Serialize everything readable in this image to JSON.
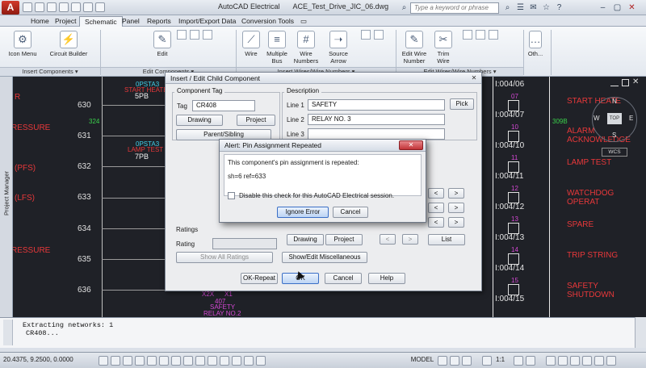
{
  "app": {
    "title_app": "AutoCAD Electrical",
    "title_file": "ACE_Test_Drive_JIC_06.dwg",
    "logo_letter": "A",
    "search_placeholder": "Type a keyword or phrase"
  },
  "tabs": [
    "Home",
    "Project",
    "Schematic",
    "Panel",
    "Reports",
    "Import/Export Data",
    "Conversion Tools"
  ],
  "ribbon": {
    "buttons": {
      "icon_menu": "Icon Menu",
      "circuit_builder": "Circuit Builder",
      "edit": "Edit",
      "wire": "Wire",
      "multiple_bus": "Multiple Bus",
      "wire_numbers": "Wire Numbers",
      "source_arrow": "Source Arrow",
      "edit_wire_number": "Edit Wire Number",
      "trim_wire": "Trim Wire",
      "other": "Oth..."
    },
    "panels": {
      "insert_components": "Insert Components ▾",
      "edit_components": "Edit Components ▾",
      "insert_wires": "Insert Wires/Wire Numbers ▾",
      "edit_wires": "Edit Wires/Wire Numbers ▾"
    }
  },
  "drawing": {
    "left_labels": [
      "R",
      "RESSURE",
      "(PFS)",
      "(LFS)",
      "RESSURE"
    ],
    "rungs": [
      "630",
      "631",
      "632",
      "633",
      "634",
      "635",
      "636"
    ],
    "green_label": "324",
    "green_label_right": "309B",
    "components": [
      {
        "tag": "0PSTA3",
        "desc": "START HEATER",
        "pb": "5PB"
      },
      {
        "tag": "0PSTA3",
        "desc": "LAMP TEST",
        "pb": "7PB"
      }
    ],
    "bottom_labels": [
      "X2X",
      "X1",
      "407",
      "SAFETY",
      "RELAY NO.2"
    ],
    "addresses": [
      "I:004/06",
      "I:004/07",
      "I:004/10",
      "I:004/11",
      "I:004/12",
      "I:004/13",
      "I:004/14",
      "I:004/15"
    ],
    "mag_numbers": [
      "07",
      "10",
      "11",
      "12",
      "13",
      "14",
      "15"
    ],
    "right_labels": [
      "START HEATE",
      "ALARM ACKNOWLEDGE",
      "LAMP TEST",
      "WATCHDOG OPERAT",
      "SPARE",
      "TRIP STRING",
      "SAFETY SHUTDOWN"
    ],
    "viewcube": {
      "n": "N",
      "w": "W",
      "e": "E",
      "s": "S",
      "top": "TOP",
      "wcs": "WCS"
    },
    "project_manager": "Project Manager"
  },
  "dialog_main": {
    "title": "Insert / Edit Child Component",
    "close": "✕",
    "component_tag_group": "Component Tag",
    "tag_label": "Tag",
    "tag_value": "CR408",
    "drawing_btn": "Drawing",
    "project_btn": "Project",
    "parent_sibling_btn": "Parent/Sibling",
    "description_group": "Description",
    "line1_label": "Line 1",
    "line1_value": "SAFETY",
    "line2_label": "Line 2",
    "line2_value": "RELAY NO. 3",
    "line3_label": "Line 3",
    "line3_value": "",
    "pick_btn": "Pick",
    "ratings_label": "Ratings",
    "rating_label": "Rating",
    "show_all_ratings_btn": "Show All Ratings",
    "drawing_btn2": "Drawing",
    "project_btn2": "Project",
    "list_btn": "List",
    "show_edit_misc_btn": "Show/Edit Miscellaneous",
    "ok_repeat_btn": "OK-Repeat",
    "ok_btn": "OK",
    "cancel_btn": "Cancel",
    "help_btn": "Help",
    "prev_arrow": "<",
    "next_arrow": ">"
  },
  "dialog_alert": {
    "title": "Alert: Pin Assignment Repeated",
    "close": "✕",
    "message": "This component's pin assignment is repeated:",
    "detail": "sh=6 ref=633",
    "disable_check_label": "Disable this check for this AutoCAD Electrical session.",
    "disable_checked": false,
    "ignore_error_btn": "Ignore Error",
    "cancel_btn": "Cancel"
  },
  "command_line": {
    "line1": "Extracting networks: 1",
    "line2": "CR408..."
  },
  "status_bar": {
    "coords": "20.4375, 9.2500, 0.0000",
    "model": "MODEL",
    "scale": "1:1"
  }
}
